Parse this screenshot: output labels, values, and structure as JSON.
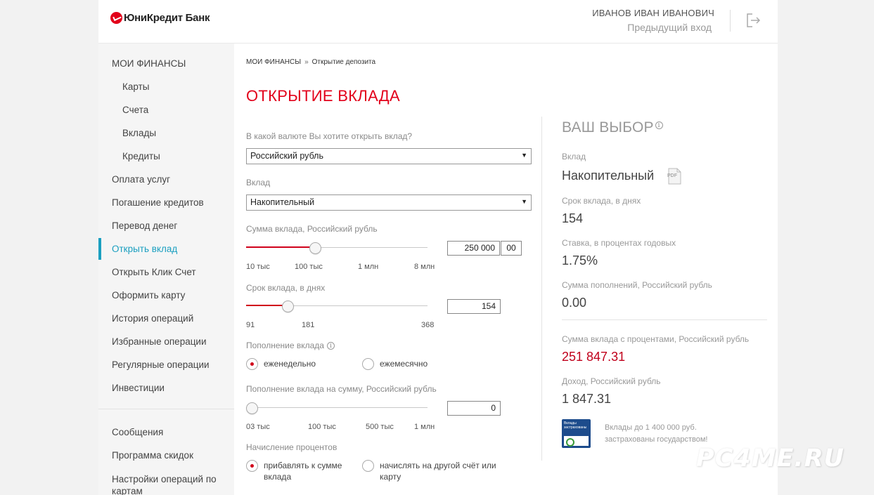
{
  "header": {
    "brand": "ЮниКредит Банк",
    "user_name": "ИВАНОВ ИВАН ИВАНОВИЧ",
    "prev_login": "Предыдущий вход",
    "logout_icon": "logout-icon"
  },
  "sidebar": {
    "items": [
      {
        "label": "МОИ ФИНАНСЫ"
      },
      {
        "label": "Карты"
      },
      {
        "label": "Счета"
      },
      {
        "label": "Вклады"
      },
      {
        "label": "Кредиты"
      },
      {
        "label": "Оплата услуг"
      },
      {
        "label": "Погашение кредитов"
      },
      {
        "label": "Перевод денег"
      },
      {
        "label": "Открыть вклад"
      },
      {
        "label": "Открыть Клик Счет"
      },
      {
        "label": "Оформить карту"
      },
      {
        "label": "История операций"
      },
      {
        "label": "Избранные операции"
      },
      {
        "label": "Регулярные операции"
      },
      {
        "label": "Инвестиции"
      }
    ],
    "bottom_items": [
      {
        "label": "Сообщения"
      },
      {
        "label": "Программа скидок"
      },
      {
        "label": "Настройки операций по картам"
      }
    ],
    "active_color": "#1a9fc0"
  },
  "breadcrumb": {
    "root": "МОИ ФИНАНСЫ",
    "separator": "»",
    "current": "Открытие депозита"
  },
  "page_title": "ОТКРЫТИЕ ВКЛАДА",
  "form": {
    "currency": {
      "label": "В какой валюте Вы хотите открыть вклад?",
      "value": "Российский рубль"
    },
    "deposit": {
      "label": "Вклад",
      "value": "Накопительный"
    },
    "amount": {
      "label": "Сумма вклада, Российский рубль",
      "value": "250 000",
      "cents": "00",
      "ticks": [
        "10 тыс",
        "100 тыс",
        "1 млн",
        "8 млн"
      ],
      "level": 0.38
    },
    "term": {
      "label": "Срок вклада, в днях",
      "value": "154",
      "ticks": [
        "91",
        "181",
        "368"
      ],
      "level": 0.23
    },
    "topup": {
      "label": "Пополнение вклада",
      "options": [
        "еженедельно",
        "ежемесячно"
      ],
      "selected": 0
    },
    "topup_amount": {
      "label": "Пополнение вклада на сумму, Российский рубль",
      "value": "0",
      "ticks": [
        "03 тыс",
        "100 тыс",
        "500 тыс",
        "1 млн"
      ],
      "level": 0
    },
    "interest": {
      "label": "Начисление процентов",
      "options": [
        "прибавлять к сумме\nвклада",
        "начислять на другой счёт или\nкарту"
      ],
      "selected": 0
    }
  },
  "summary": {
    "title": "ВАШ ВЫБОР",
    "deposit_label": "Вклад",
    "deposit_value": "Накопительный",
    "pdf_label": "PDF",
    "term_label": "Срок вклада, в днях",
    "term_value": "154",
    "rate_label": "Ставка, в процентах годовых",
    "rate_value": "1.75%",
    "topups_label": "Сумма пополнений, Российский рубль",
    "topups_value": "0.00",
    "total_label": "Сумма вклада с процентами, Российский рубль",
    "total_value": "251 847.31",
    "income_label": "Доход, Российский рубль",
    "income_value": "1 847.31",
    "badge_text": "Вклады застрахованы",
    "insured_line1": "Вклады до 1 400 000 руб.",
    "insured_line2": "застрахованы государством!"
  },
  "watermark": "PC4ME.RU",
  "colors": {
    "brand_red": "#e2001a",
    "accent_blue": "#1a9fc0"
  }
}
